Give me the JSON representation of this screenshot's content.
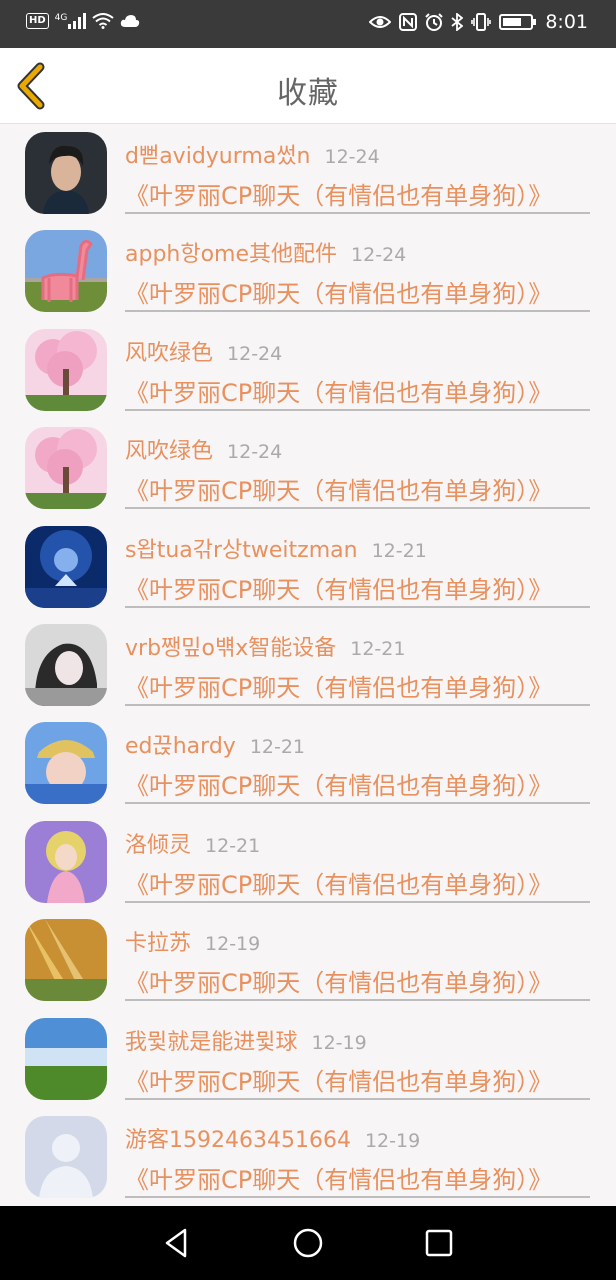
{
  "status_bar": {
    "left_icons": [
      "hd-icon",
      "signal-icon",
      "wifi-icon",
      "cloud-icon"
    ],
    "network_label": "4G",
    "right_icons": [
      "eye-icon",
      "nfc-icon",
      "alarm-icon",
      "bluetooth-icon",
      "vibrate-icon",
      "battery-icon"
    ],
    "time": "8:01"
  },
  "header": {
    "title": "收藏",
    "back_icon": "chevron-left-icon",
    "accent_color": "#e9a900"
  },
  "colors": {
    "name_text": "#e8915e",
    "date_text": "#aaaaaa",
    "divider": "#bdbdbd",
    "background": "#f7f5f6"
  },
  "items": [
    {
      "name": "d뻗avidyurma썼n",
      "date": "12-24",
      "title": "《叶罗丽CP聊天（有情侣也有单身狗）》",
      "avatar": "avatar-man-photo"
    },
    {
      "name": "apph항ome其他配件",
      "date": "12-24",
      "title": "《叶罗丽CP聊天（有情侣也有单身狗）》",
      "avatar": "avatar-pink-llama"
    },
    {
      "name": "风吹绿色",
      "date": "12-24",
      "title": "《叶罗丽CP聊天（有情侣也有单身狗）》",
      "avatar": "avatar-cherry-tree"
    },
    {
      "name": "风吹绿色",
      "date": "12-24",
      "title": "《叶罗丽CP聊天（有情侣也有单身狗）》",
      "avatar": "avatar-cherry-tree"
    },
    {
      "name": "s왑tua갂r상tweitzman",
      "date": "12-21",
      "title": "《叶罗丽CP聊天（有情侣也有单身狗）》",
      "avatar": "avatar-blue-night"
    },
    {
      "name": "vrb쨍밒o뱪x智能设备",
      "date": "12-21",
      "title": "《叶罗丽CP聊天（有情侣也有单身狗）》",
      "avatar": "avatar-girl-bw"
    },
    {
      "name": "ed끉hardy",
      "date": "12-21",
      "title": "《叶罗丽CP聊天（有情侣也有单身狗）》",
      "avatar": "avatar-boy-hat"
    },
    {
      "name": "洛倾灵",
      "date": "12-21",
      "title": "《叶罗丽CP聊天（有情侣也有单身狗）》",
      "avatar": "avatar-doll"
    },
    {
      "name": "卡拉苏",
      "date": "12-19",
      "title": "《叶罗丽CP聊天（有情侣也有单身狗）》",
      "avatar": "avatar-sunlight"
    },
    {
      "name": "我뮟就是能进뮟球",
      "date": "12-19",
      "title": "《叶罗丽CP聊天（有情侣也有单身狗）》",
      "avatar": "avatar-grassland"
    },
    {
      "name": "游客1592463451664",
      "date": "12-19",
      "title": "《叶罗丽CP聊天（有情侣也有单身狗）》",
      "avatar": "avatar-default-user"
    }
  ],
  "nav_bar": {
    "buttons": [
      "back-triangle-icon",
      "home-circle-icon",
      "recents-square-icon"
    ]
  }
}
